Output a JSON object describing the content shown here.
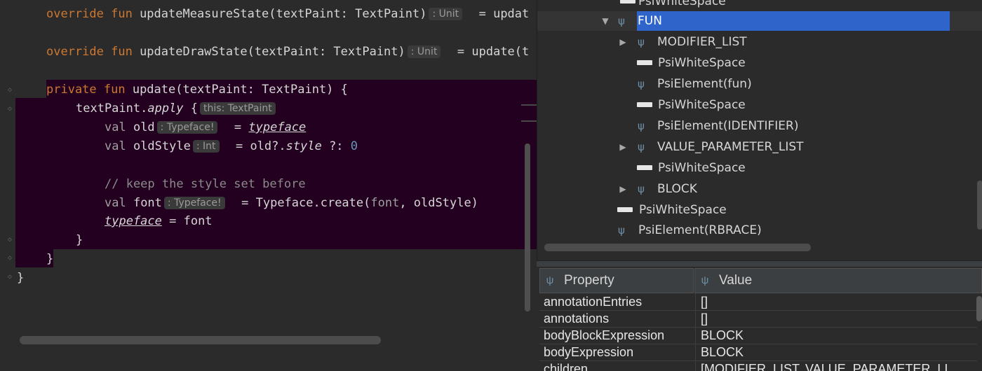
{
  "editor": {
    "lines": [
      {
        "kw": "override fun ",
        "name": "updateMeasureState",
        "params": "(textPaint: TextPaint)",
        "hint": ": Unit",
        "rest": "  = updat"
      },
      {
        "kw": "override fun ",
        "name": "updateDrawState",
        "params": "(textPaint: TextPaint)",
        "hint": ": Unit",
        "rest": "  = update(t"
      },
      {
        "kw": "private fun ",
        "name": "update",
        "params": "(textPaint: TextPaint) {"
      },
      {
        "recv": "textPaint.",
        "call": "apply",
        "brace": " {",
        "hint": "this: TextPaint"
      },
      {
        "kw": "val ",
        "name": "old",
        "hint": ": Typeface!",
        "eq": "  = ",
        "ref": "typeface"
      },
      {
        "kw": "val ",
        "name": "oldStyle",
        "hint": ": Int",
        "eq": "  = old?.",
        "ref": "style",
        "tail": " ?: ",
        "num": "0"
      },
      {
        "comment": "// keep the style set before"
      },
      {
        "kw": "val ",
        "name": "font",
        "hint": ": Typeface!",
        "eq": "  = Typeface.create(",
        "arg1": "font",
        "tail": ", oldStyle)"
      },
      {
        "ref": "typeface",
        "tail": " = font"
      },
      {
        "brace": "}"
      },
      {
        "brace": "}"
      },
      {
        "brace": "}"
      }
    ]
  },
  "tree": {
    "nodes": [
      {
        "label": "PsiWhiteSpace"
      },
      {
        "label": "FUN"
      },
      {
        "label": "MODIFIER_LIST"
      },
      {
        "label": "PsiWhiteSpace"
      },
      {
        "label": "PsiElement(fun)"
      },
      {
        "label": "PsiWhiteSpace"
      },
      {
        "label": "PsiElement(IDENTIFIER)"
      },
      {
        "label": "VALUE_PARAMETER_LIST"
      },
      {
        "label": "PsiWhiteSpace"
      },
      {
        "label": "BLOCK"
      },
      {
        "label": "PsiWhiteSpace"
      },
      {
        "label": "PsiElement(RBRACE)"
      }
    ],
    "selection_color": "#2f65ca"
  },
  "properties": {
    "headers": {
      "property": "Property",
      "value": "Value"
    },
    "rows": [
      {
        "name": "annotationEntries",
        "value": "[]"
      },
      {
        "name": "annotations",
        "value": "[]"
      },
      {
        "name": "bodyBlockExpression",
        "value": "BLOCK"
      },
      {
        "name": "bodyExpression",
        "value": "BLOCK"
      },
      {
        "name": "children",
        "value": "[MODIFIER_LIST, VALUE_PARAMETER_LI"
      }
    ]
  },
  "icons": {
    "psi": "psi-icon",
    "whitespace": "whitespace-icon",
    "expand": "expand-arrow-icon",
    "collapse": "collapse-arrow-icon"
  },
  "colors": {
    "background": "#2b2b2b",
    "selection_block": "#23001f",
    "keyword": "#cc7832",
    "number": "#6897bb"
  }
}
